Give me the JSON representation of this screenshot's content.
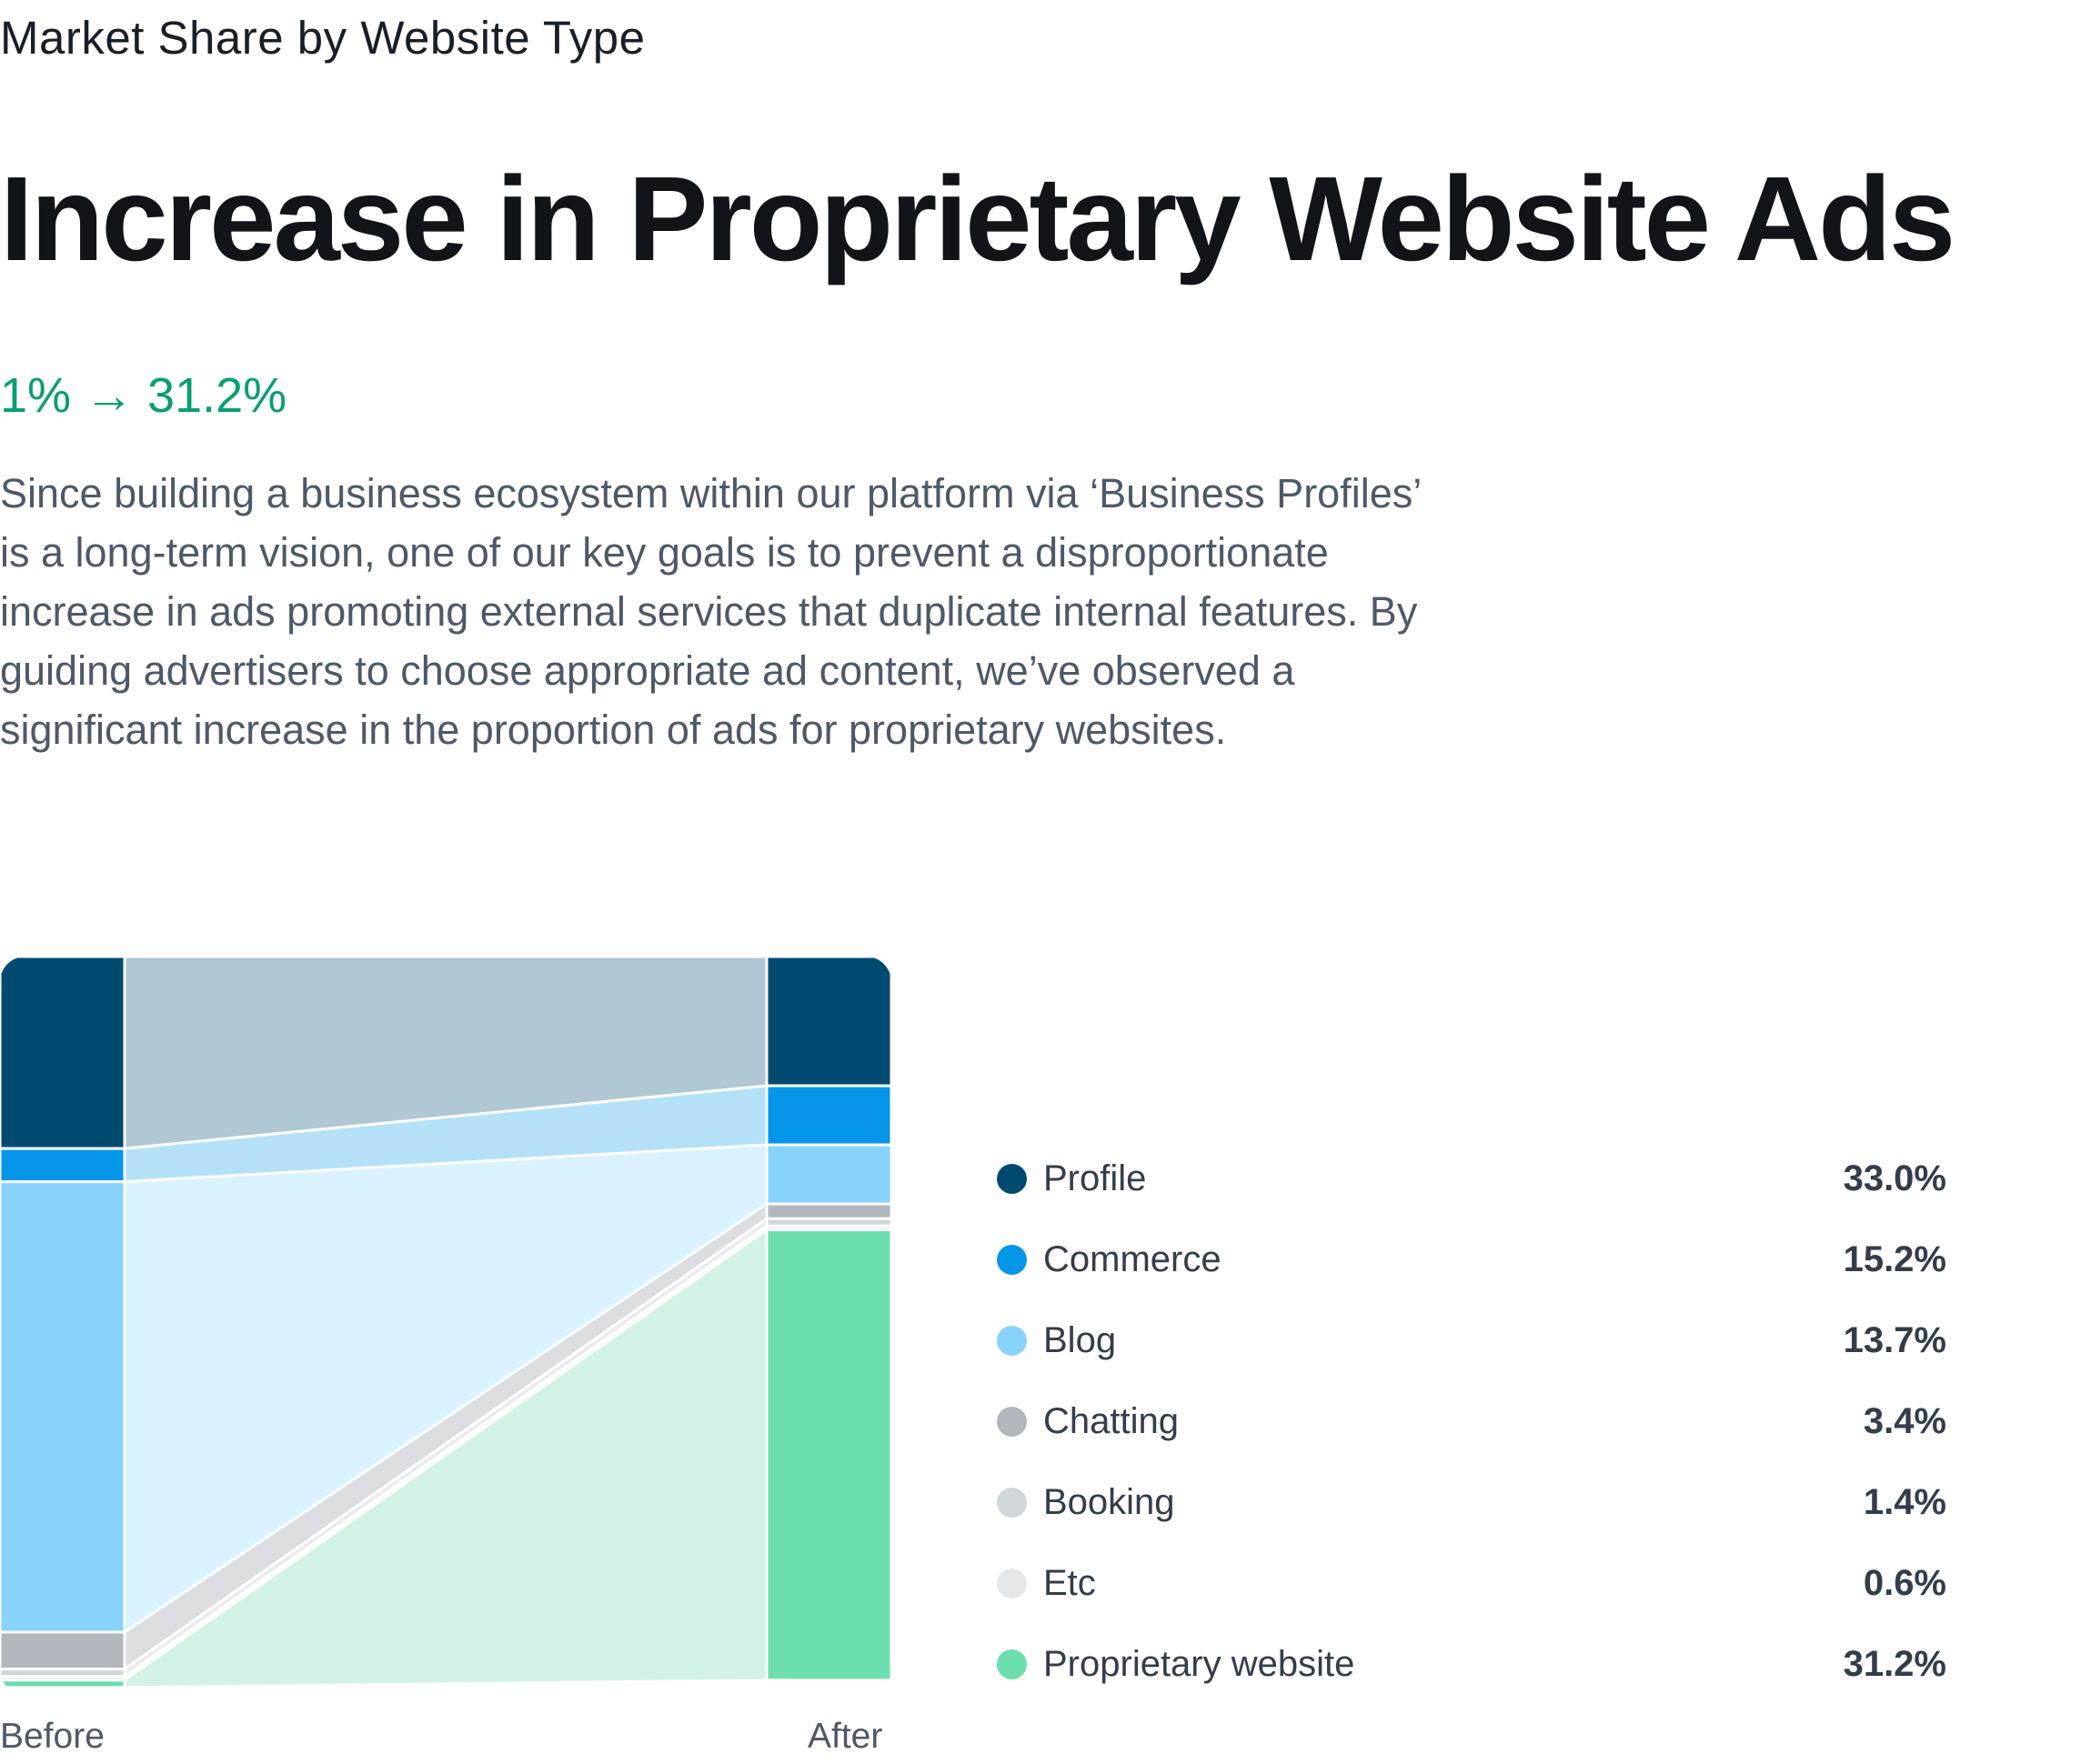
{
  "header": {
    "eyebrow": "Market Share by Website Type",
    "title": "Increase in Proprietary Website Ads",
    "stat": "1% → 31.2%",
    "description": "Since building a business ecosystem within our platform via ‘Business Profiles’ is a long-term vision, one of our key goals is to prevent a disproportionate increase in ads promoting external services that duplicate internal features. By guiding advertisers to choose appropriate ad content, we’ve observed a significant increase in the proportion of ads for proprietary websites."
  },
  "colors": {
    "accent_green": "#0a9e74",
    "text_primary": "#191f28",
    "text_secondary": "#4e5968"
  },
  "chart_data": {
    "type": "area",
    "subtype": "100%-stacked before/after flow",
    "categories": [
      "Before",
      "After"
    ],
    "series": [
      {
        "name": "Profile",
        "values": [
          26.0,
          17.5
        ],
        "legend_value": "33.0%",
        "color": "#004a70",
        "flow_color": "#b0c7d4"
      },
      {
        "name": "Commerce",
        "values": [
          4.5,
          8.0
        ],
        "legend_value": "15.2%",
        "color": "#0596ea",
        "flow_color": "#b4e1f8"
      },
      {
        "name": "Blog",
        "values": [
          61.0,
          8.0
        ],
        "legend_value": "13.7%",
        "color": "#88d3fc",
        "flow_color": "#daf2fe"
      },
      {
        "name": "Chatting",
        "values": [
          5.0,
          2.0
        ],
        "legend_value": "3.4%",
        "color": "#b2b7bd",
        "flow_color": "#dcdde0"
      },
      {
        "name": "Booking",
        "values": [
          1.0,
          1.0
        ],
        "legend_value": "1.4%",
        "color": "#d1d6db",
        "flow_color": "#e9ebee"
      },
      {
        "name": "Etc",
        "values": [
          0.5,
          0.5
        ],
        "legend_value": "0.6%",
        "color": "#e5e8eb",
        "flow_color": "#f2f3f5"
      },
      {
        "name": "Proprietary website",
        "values": [
          1.0,
          61.0
        ],
        "legend_value": "31.2%",
        "color": "#6ddead",
        "flow_color": "#d2f3e3"
      }
    ],
    "ylim": [
      0,
      100
    ],
    "legend_position": "right"
  }
}
